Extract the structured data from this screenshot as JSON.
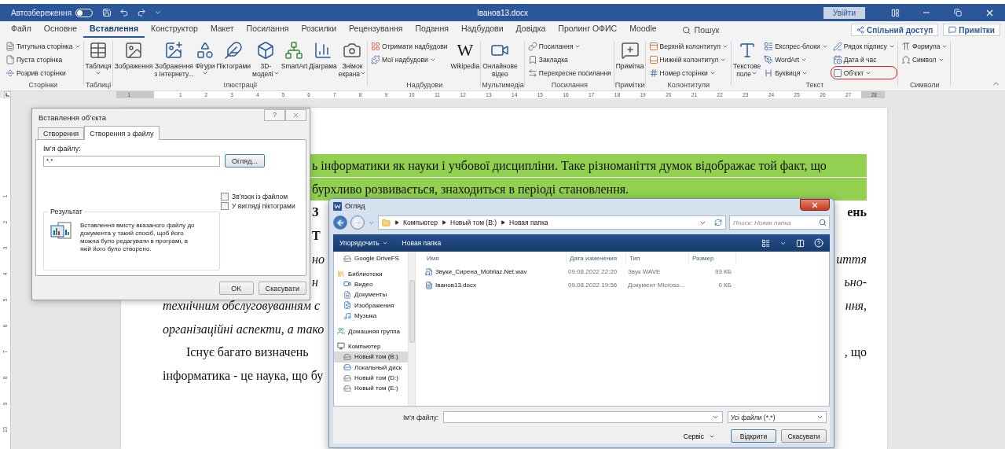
{
  "title_bar": {
    "autosave_label": "Автозбереження",
    "autosave_on": false,
    "document_title": "Іванов13.docx",
    "sign_in": "Увійти"
  },
  "menu_tabs": [
    {
      "label": "Файл",
      "selected": false
    },
    {
      "label": "Основне",
      "selected": false
    },
    {
      "label": "Вставлення",
      "selected": true
    },
    {
      "label": "Конструктор",
      "selected": false
    },
    {
      "label": "Макет",
      "selected": false
    },
    {
      "label": "Посилання",
      "selected": false
    },
    {
      "label": "Розсилки",
      "selected": false
    },
    {
      "label": "Рецензування",
      "selected": false
    },
    {
      "label": "Подання",
      "selected": false
    },
    {
      "label": "Надбудови",
      "selected": false
    },
    {
      "label": "Довідка",
      "selected": false
    },
    {
      "label": "Пролинг ОФИС",
      "selected": false
    },
    {
      "label": "Moodle",
      "selected": false
    }
  ],
  "search": {
    "label": "Пошук"
  },
  "share_button": "Спільний доступ",
  "comments_button": "Примітки",
  "ribbon_groups": [
    {
      "label": "Сторінки",
      "items": [
        {
          "kind": "small",
          "label": "Титульна сторінка",
          "dropdown": true
        },
        {
          "kind": "small",
          "label": "Пуста сторінка",
          "dropdown": false
        },
        {
          "kind": "small",
          "label": "Розрив сторінки",
          "dropdown": false
        }
      ]
    },
    {
      "label": "Таблиці",
      "items": [
        {
          "kind": "large",
          "label": "Таблиця",
          "dropdown": true
        }
      ]
    },
    {
      "label": "Ілюстрації",
      "items": [
        {
          "kind": "large",
          "label": "Зображення",
          "dropdown": false
        },
        {
          "kind": "large",
          "label": "Зображення\nз Інтернету...",
          "dropdown": false
        },
        {
          "kind": "large",
          "label": "Фігури",
          "dropdown": true
        },
        {
          "kind": "large",
          "label": "Піктограми",
          "dropdown": false
        },
        {
          "kind": "large",
          "label": "3D-\nмоделі",
          "dropdown": true
        },
        {
          "kind": "large",
          "label": "SmartArt",
          "dropdown": false
        },
        {
          "kind": "large",
          "label": "Діаграма",
          "dropdown": false
        },
        {
          "kind": "large",
          "label": "Знімок\nекрана",
          "dropdown": true
        }
      ]
    },
    {
      "label": "Надбудови",
      "items": [
        {
          "kind": "small",
          "label": "Отримати надбудови",
          "dropdown": false
        },
        {
          "kind": "small",
          "label": "Мої надбудови",
          "dropdown": true
        },
        {
          "kind": "large",
          "label": "Wikipedia",
          "glyph": "W",
          "dropdown": false
        }
      ]
    },
    {
      "label": "Мультимедіа",
      "items": [
        {
          "kind": "large",
          "label": "Онлайнове\nвідео",
          "dropdown": false
        }
      ]
    },
    {
      "label": "Посилання",
      "items": [
        {
          "kind": "small",
          "label": "Посилання",
          "dropdown": true
        },
        {
          "kind": "small",
          "label": "Закладка",
          "dropdown": false
        },
        {
          "kind": "small",
          "label": "Перехресне посилання",
          "dropdown": false
        }
      ]
    },
    {
      "label": "Примітки",
      "items": [
        {
          "kind": "large",
          "label": "Примітка",
          "dropdown": false
        }
      ]
    },
    {
      "label": "Колонтитули",
      "items": [
        {
          "kind": "small",
          "label": "Верхній колонтитул",
          "dropdown": true
        },
        {
          "kind": "small",
          "label": "Нижній колонтитул",
          "dropdown": true
        },
        {
          "kind": "small",
          "label": "Номер сторінки",
          "dropdown": true
        }
      ]
    },
    {
      "label": "Текст",
      "items": [
        {
          "kind": "large",
          "label": "Текстове\nполе",
          "dropdown": true
        },
        {
          "kind": "small",
          "label": "Експрес-блоки",
          "dropdown": true
        },
        {
          "kind": "small",
          "label": "WordArt",
          "dropdown": true
        },
        {
          "kind": "small",
          "label": "Буквиця",
          "dropdown": true
        },
        {
          "kind": "small",
          "label": "Рядок підпису",
          "dropdown": true
        },
        {
          "kind": "small",
          "label": "Дата й час",
          "dropdown": false
        },
        {
          "kind": "small",
          "label": "Об’єкт",
          "dropdown": true,
          "highlighted": true
        }
      ]
    },
    {
      "label": "Символи",
      "items": [
        {
          "kind": "small",
          "label": "Формула",
          "dropdown": true
        },
        {
          "kind": "small",
          "label": "Символ",
          "dropdown": true
        }
      ]
    }
  ],
  "ruler": {
    "numbers": [
      "1",
      "1",
      "2",
      "3",
      "4",
      "5",
      "6",
      "7",
      "8",
      "9",
      "10",
      "11",
      "12",
      "13",
      "14",
      "15",
      "16",
      "17",
      "18",
      "19",
      "20",
      "21",
      "22",
      "23",
      "24",
      "25",
      "26",
      "27",
      "28"
    ]
  },
  "vertical_ruler": {
    "numbers": [
      "1",
      "2",
      "3",
      "4",
      "5",
      "6",
      "7",
      "8",
      "9",
      "10"
    ]
  },
  "document": {
    "lines": [
      {
        "kind": "plain",
        "highlighted": true,
        "left": "ь інформатики як науки і учбової дисципліни. Таке різноманіття думок відображає той факт, що"
      },
      {
        "kind": "plain",
        "highlighted": true,
        "left": "бурхливо розвивається, знаходиться в періоді становлення."
      },
      {
        "kind": "heading",
        "highlighted": false,
        "left": "З",
        "right": "ень"
      },
      {
        "kind": "heading",
        "highlighted": false,
        "left": "Т"
      },
      {
        "kind": "emphasis",
        "highlighted": false,
        "left": "но",
        "right": "иття"
      },
      {
        "kind": "emphasis",
        "highlighted": false,
        "left": "н",
        "right": "ьно-"
      },
      {
        "kind": "definition",
        "highlighted": false,
        "left": "технічним обслуговуванням с",
        "right": "ння,"
      },
      {
        "kind": "definition",
        "highlighted": false,
        "left": "організаційні аспекти, а тако"
      },
      {
        "kind": "indent",
        "highlighted": false,
        "left": "Існує багато визначень",
        "right": ", що"
      },
      {
        "kind": "body",
        "highlighted": false,
        "left": "інформатика - це наука, що бу"
      }
    ]
  },
  "insert_object_dialog": {
    "title": "Вставлення об’єкта",
    "help": "?",
    "tabs": [
      {
        "label": "Створення",
        "selected": false
      },
      {
        "label": "Створення з файлу",
        "selected": true
      }
    ],
    "file_name_label": "Ім’я файлу:",
    "file_name_value": "*.*",
    "browse_button": "Огляд...",
    "options": [
      {
        "label": "Зв’язок із файлом",
        "checked": false
      },
      {
        "label": "У вигляді піктограми",
        "checked": false
      }
    ],
    "result_title": "Результат",
    "result_text": "Вставлення вмісту вказаного файлу до документа у такий спосіб, щоб його можна було редагувати в програмі, в якій його було створено.",
    "buttons": [
      "OK",
      "Скасувати"
    ]
  },
  "browse_dialog": {
    "title": "Огляд",
    "path": [
      "Компьютер",
      "Новый том (B:)",
      "Новая папка"
    ],
    "search_placeholder": "Поиск: Новая папка",
    "organize_button": "Упорядочить",
    "new_folder_button": "Новая папка",
    "nav": [
      {
        "children": [
          {
            "label": "Google DriveFS",
            "kind": "drive",
            "selected": false
          }
        ]
      },
      {
        "label": "Библиотеки",
        "kind": "library",
        "selected": false,
        "children": [
          {
            "label": "Видео",
            "kind": "video",
            "selected": false
          },
          {
            "label": "Документы",
            "kind": "documents",
            "selected": false
          },
          {
            "label": "Изображения",
            "kind": "images",
            "selected": false
          },
          {
            "label": "Музыка",
            "kind": "music",
            "selected": false
          }
        ]
      },
      {
        "label": "Домашняя группа",
        "kind": "homegroup",
        "selected": false
      },
      {
        "label": "Компьютер",
        "kind": "computer",
        "selected": false,
        "children": [
          {
            "label": "Новый том (B:)",
            "kind": "drive",
            "selected": true
          },
          {
            "label": "Локальный диск",
            "kind": "system_drive",
            "selected": false
          },
          {
            "label": "Новый том (D:)",
            "kind": "drive",
            "selected": false
          },
          {
            "label": "Новый том (E:)",
            "kind": "drive",
            "selected": false
          }
        ]
      }
    ],
    "columns": [
      "Имя",
      "Дата изменения",
      "Тип",
      "Размер"
    ],
    "files": [
      {
        "kind": "audio",
        "name": "Звуки_Сирена_Mobilaz.Net.wav",
        "modified": "09.08.2022 22:20",
        "type": "Звук WAVE",
        "size": "93 КБ"
      },
      {
        "kind": "word",
        "name": "Іванов13.docx",
        "modified": "09.08.2022 19:56",
        "type": "Документ Microso...",
        "size": "0 КБ"
      }
    ],
    "file_name_label": "Ім’я файлу:",
    "file_type": "Усі файли (*.*)",
    "tools_button": "Сервіс",
    "buttons": [
      "Відкрити",
      "Скасувати"
    ]
  }
}
